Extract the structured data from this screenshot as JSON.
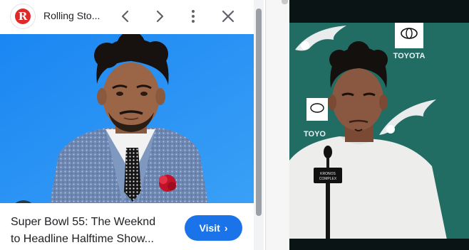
{
  "panel": {
    "site_name": "Rolling Sto...",
    "favicon_letter": "R",
    "favicon_color": "#e02a2a",
    "icons": {
      "prev": "chevron-left-icon",
      "next": "chevron-right-icon",
      "more": "more-vert-icon",
      "close": "close-icon",
      "lens": "lens-search-icon"
    },
    "caption_line1": "Super Bowl 55: The Weeknd",
    "caption_line2": "to Headline Halftime Show...",
    "visit_label": "Visit",
    "visit_arrow": "›",
    "accent": "#1a73e8"
  },
  "video": {
    "backdrop_brand": "TOYOTA",
    "backdrop_brand_partial": "TOYO",
    "mic_label_line1": "KRONOS",
    "mic_label_line2": "COMPLEX"
  }
}
